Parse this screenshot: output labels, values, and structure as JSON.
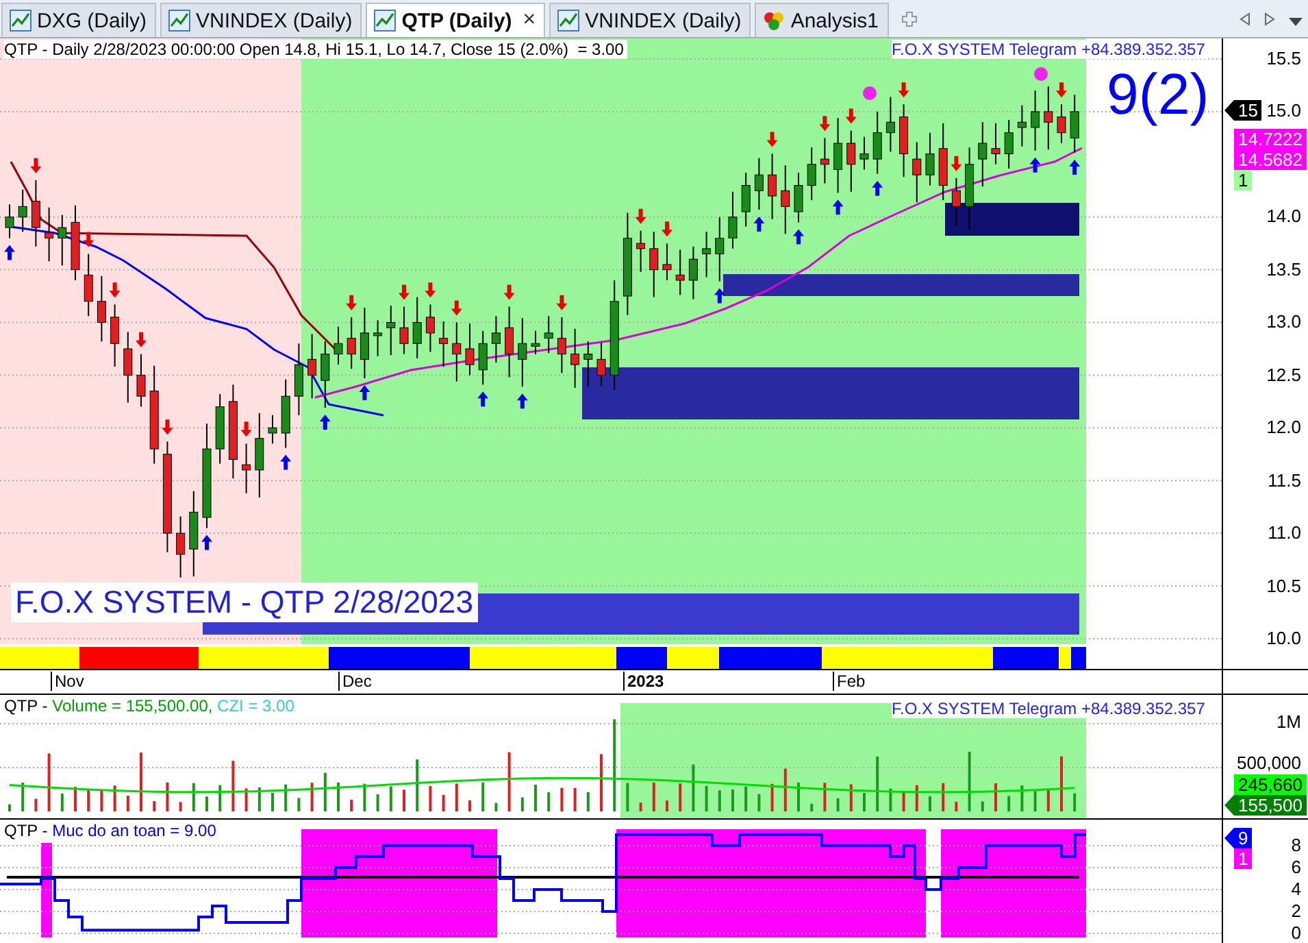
{
  "tabs": [
    {
      "label": "DXG (Daily)",
      "kind": "chart",
      "selected": false
    },
    {
      "label": "VNINDEX (Daily)",
      "kind": "chart",
      "selected": false
    },
    {
      "label": "QTP (Daily)",
      "kind": "chart",
      "selected": true
    },
    {
      "label": "VNINDEX (Daily)",
      "kind": "chart",
      "selected": false
    },
    {
      "label": "Analysis1",
      "kind": "analysis",
      "selected": false
    }
  ],
  "tab_close": "×",
  "price_pane": {
    "header": "QTP - Daily 2/28/2023 00:00:00 Open 14.8, Hi 15.1, Lo 14.7, Close 15 (2.0%)  = 3.00",
    "telegram": "F.O.X SYSTEM Telegram +84.389.352.357",
    "signal": "9(2)",
    "watermark_title": "F.O.X SYSTEM - QTP 2/28/2023",
    "y_labels": [
      "15.5",
      "15.0",
      "14.0",
      "13.5",
      "13.0",
      "12.5",
      "12.0",
      "11.5",
      "11.0",
      "10.5",
      "10.0"
    ],
    "badges": [
      {
        "text": "15",
        "color": "#000000",
        "kind": "pointer"
      },
      {
        "text": "14.7222",
        "color": "#ff00ff",
        "kind": "plain"
      },
      {
        "text": "14.5682",
        "color": "#ff00ff",
        "kind": "plain"
      },
      {
        "text": "1",
        "color": "#99ff99",
        "kind": "plain"
      }
    ]
  },
  "date_labels": [
    {
      "text": "Nov",
      "bold": false
    },
    {
      "text": "Dec",
      "bold": false
    },
    {
      "text": "2023",
      "bold": true
    },
    {
      "text": "Feb",
      "bold": false
    }
  ],
  "volume_pane": {
    "header": [
      {
        "text": "QTP - ",
        "color": "#000000"
      },
      {
        "text": "Volume = 155,500.00,",
        "color": "#00a000"
      },
      {
        "text": " CZI = 3.00",
        "color": "#33cccc"
      }
    ],
    "telegram": "F.O.X SYSTEM Telegram +84.389.352.357",
    "y_labels": [
      "1M",
      "500,000"
    ],
    "badges": [
      {
        "text": "245,660",
        "color": "#00ff00",
        "kind": "plain"
      },
      {
        "text": "155,500",
        "color": "#008000",
        "kind": "pointer"
      }
    ]
  },
  "safety_pane": {
    "header": [
      {
        "text": "QTP - ",
        "color": "#000000"
      },
      {
        "text": "Muc do an toan = 9.00",
        "color": "#0000ff"
      }
    ],
    "y_labels": [
      "8",
      "6",
      "4",
      "2",
      "0"
    ],
    "badges": [
      {
        "text": "9",
        "color": "#0000ff",
        "kind": "pointer"
      },
      {
        "text": "1",
        "color": "#ff00ff",
        "kind": "plain"
      }
    ]
  }
}
